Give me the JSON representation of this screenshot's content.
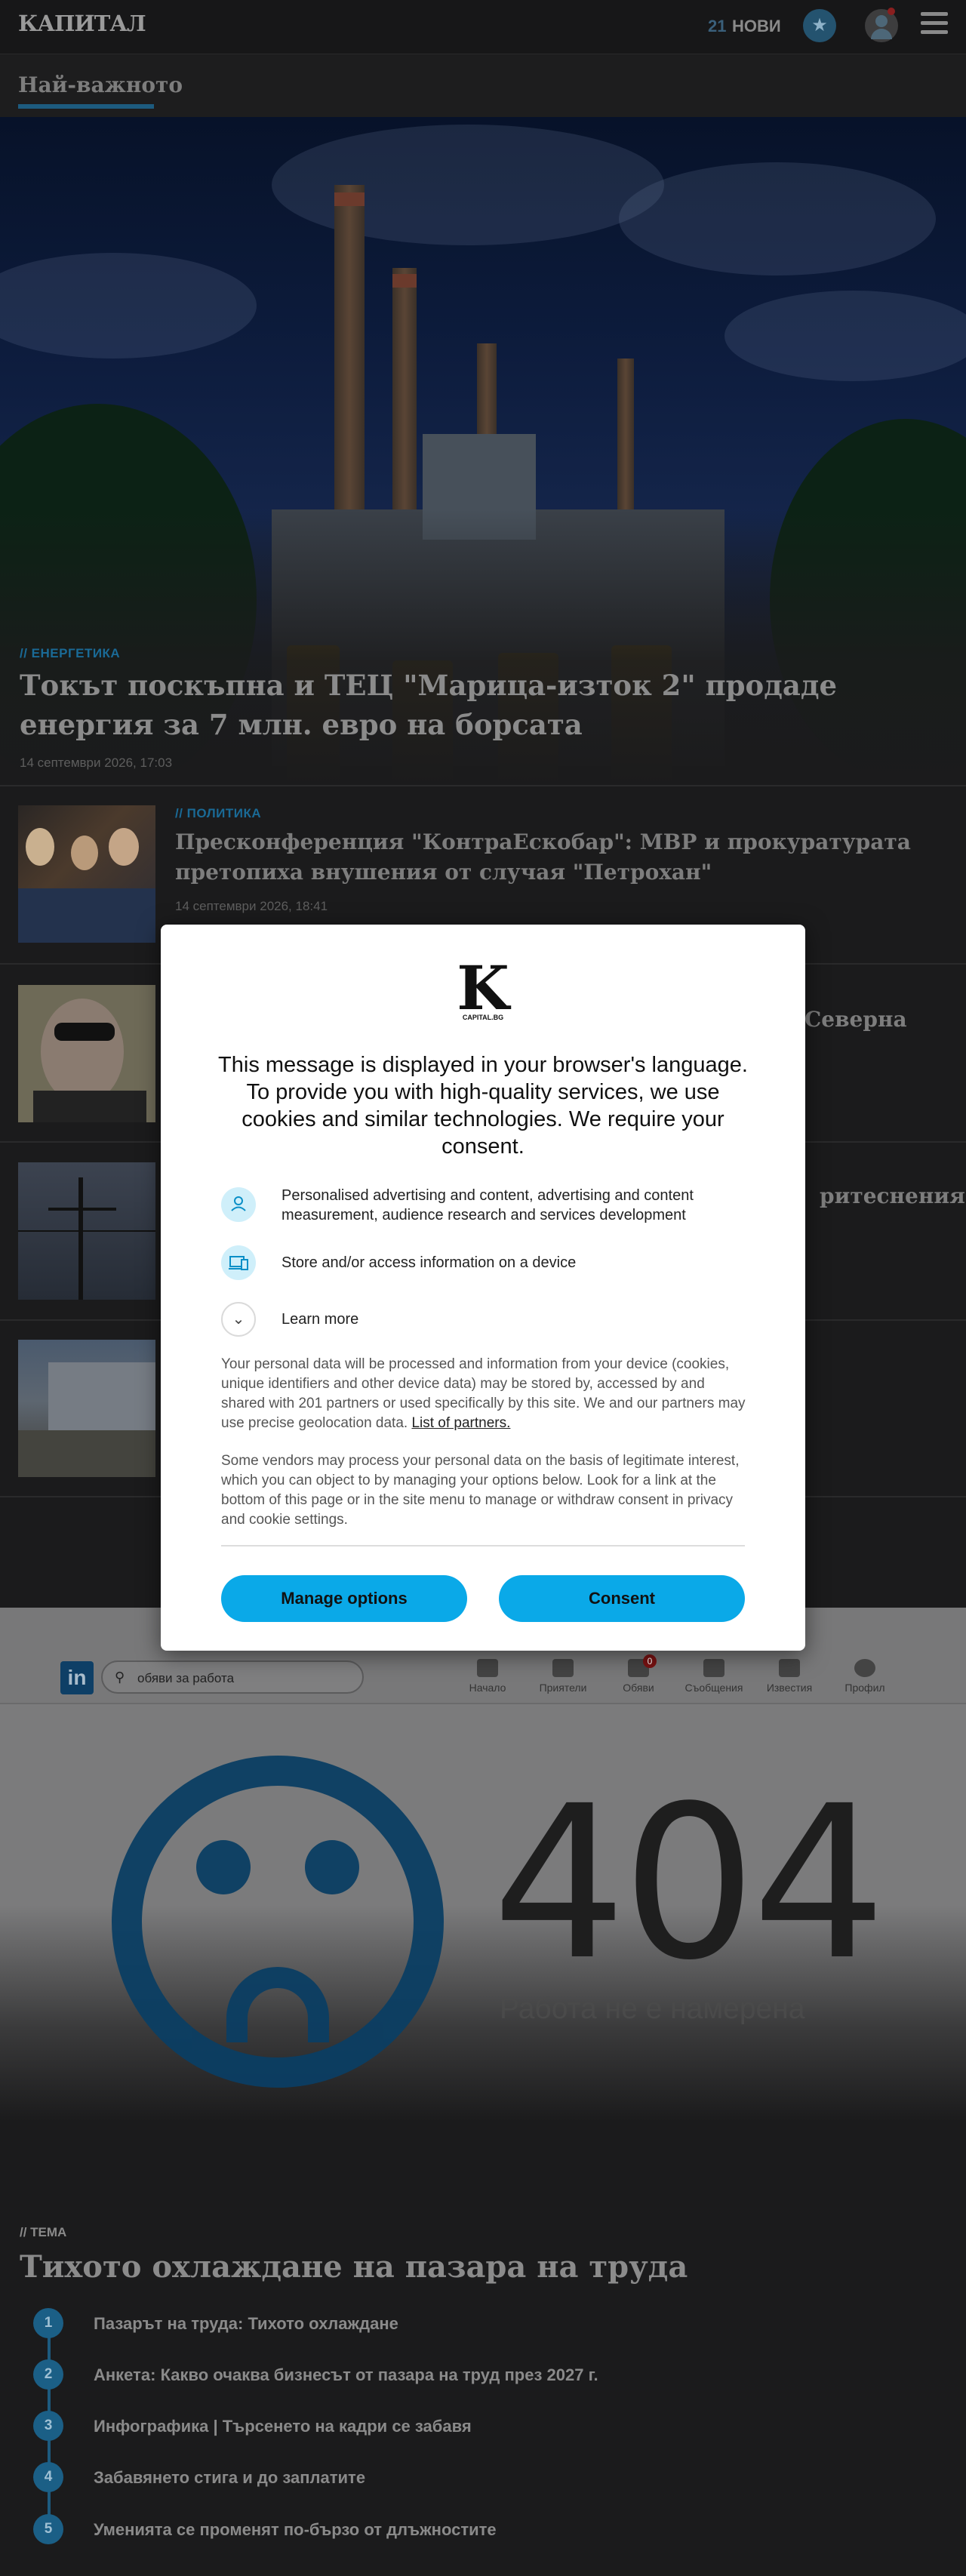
{
  "header": {
    "logo": "КАПИТАЛ",
    "new_count": "21",
    "new_label": "НОВИ",
    "section_title": "Най-важното"
  },
  "hero": {
    "kicker": "// ЕНЕРГЕТИКА",
    "title": "Токът поскъпна и ТЕЦ \"Марица-изток 2\" продаде енергия за 7 млн. евро на борсата",
    "date": "14 септември 2026, 17:03"
  },
  "articles": [
    {
      "kicker": "// ПОЛИТИКА",
      "title": "Пресконференция \"КонтраЕскобар\": МВР и прокуратурата претопиха внушения от случая \"Петрохан\"",
      "date": "14 септември 2026, 18:41"
    },
    {
      "kicker": "",
      "title": "Северна",
      "date": ""
    },
    {
      "kicker": "",
      "title": "ритеснения",
      "date": ""
    },
    {
      "kicker": "",
      "title": "",
      "date": ""
    }
  ],
  "ad": {
    "search_query": "обяви за работа",
    "nav": [
      "Начало",
      "Приятели",
      "Обяви",
      "Съобщения",
      "Известия",
      "Профил"
    ],
    "badge": "0",
    "code": "404",
    "message": "Работа не е намерена"
  },
  "topic": {
    "tag": "// ТЕМА",
    "title": "Тихото охлаждане на пазара на труда",
    "items": [
      {
        "num": "1",
        "text": "Пазарът на труда: Тихото охлаждане"
      },
      {
        "num": "2",
        "text": "Анкета: Какво очаква бизнесът от пазара на труд през 2027 г."
      },
      {
        "num": "3",
        "text": "Инфографика | Търсенето на кадри се забавя"
      },
      {
        "num": "4",
        "text": "Забавянето стига и до заплатите"
      },
      {
        "num": "5",
        "text": "Уменията се променят по-бързо от длъжностите"
      }
    ]
  },
  "consent": {
    "logo_sub": "CAPITAL.BG",
    "heading": "This message is displayed in your browser's language. To provide you with high-quality services, we use cookies and similar technologies. We require your consent.",
    "purposes": [
      {
        "icon": "person-icon",
        "text": "Personalised advertising and content, advertising and content measurement, audience research and services development"
      },
      {
        "icon": "device-icon",
        "text": "Store and/or access information on a device"
      }
    ],
    "learn_more": "Learn more",
    "para1": "Your personal data will be processed and information from your device (cookies, unique identifiers and other device data) may be stored by, accessed by and shared with 201 partners or used specifically by this site. We and our partners may use precise geolocation data.",
    "partners_link": "List of partners.",
    "para2": "Some vendors may process your personal data on the basis of legitimate interest, which you can object to by managing your options below. Look for a link at the bottom of this page or in the site menu to manage or withdraw consent in privacy and cookie settings.",
    "manage_label": "Manage options",
    "consent_label": "Consent"
  },
  "colors": {
    "accent": "#0aa9e8",
    "kicker": "#1a6a96",
    "background": "#1b1b1c"
  }
}
